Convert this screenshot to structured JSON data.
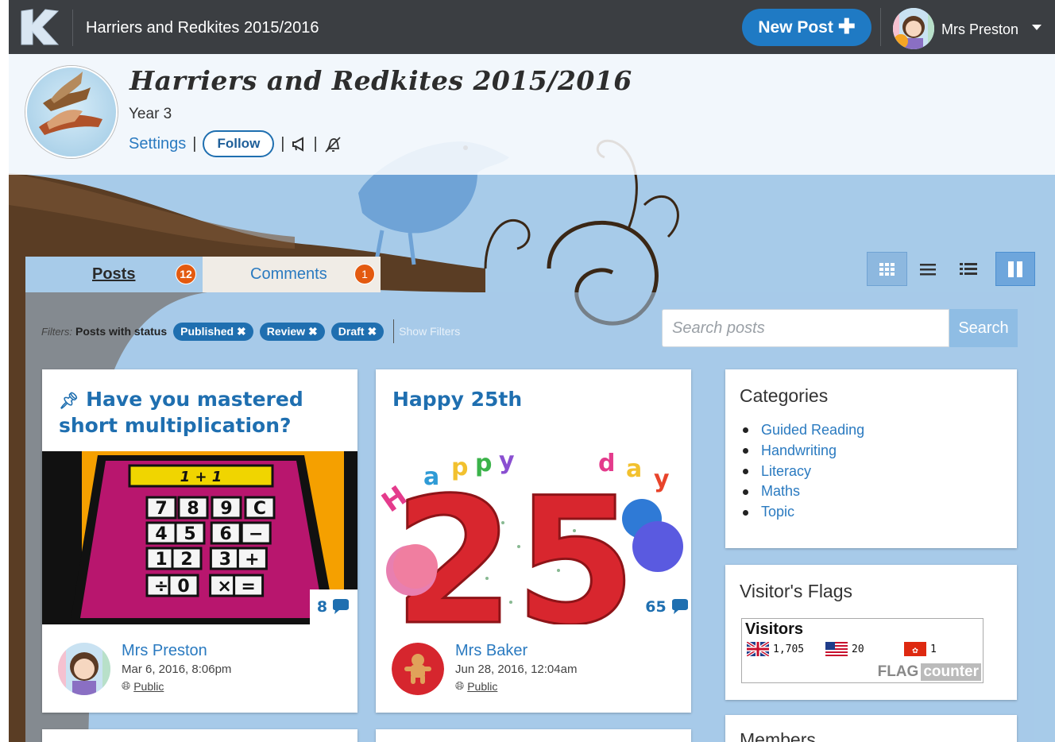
{
  "topbar": {
    "title": "Harriers and Redkites 2015/2016",
    "new_post_label": "New Post",
    "user_name": "Mrs Preston"
  },
  "header": {
    "class_title": "Harriers and Redkites 2015/2016",
    "year": "Year 3",
    "settings_label": "Settings",
    "follow_label": "Follow",
    "separator": "|"
  },
  "tabs": [
    {
      "label": "Posts",
      "count": "12"
    },
    {
      "label": "Comments",
      "count": "1"
    }
  ],
  "filters": {
    "prefix": "Filters:",
    "status_text": "Posts with status",
    "chips": [
      "Published",
      "Review",
      "Draft"
    ],
    "show_filters": "Show Filters"
  },
  "search": {
    "placeholder": "Search posts",
    "button_label": "Search"
  },
  "posts": [
    {
      "title": "Have you mastered short multiplication?",
      "pinned": true,
      "comment_count": "8",
      "author": "Mrs Preston",
      "date": "Mar 6, 2016, 8:06pm",
      "visibility": "Public"
    },
    {
      "title": "Happy 25th",
      "pinned": false,
      "comment_count": "65",
      "author": "Mrs Baker",
      "date": "Jun 28, 2016, 12:04am",
      "visibility": "Public"
    }
  ],
  "calculator_keys": [
    "7",
    "8",
    "9",
    "C",
    "4",
    "5",
    "6",
    "−",
    "1",
    "2",
    "3",
    "+",
    "÷",
    "0",
    "×",
    "="
  ],
  "calculator_display": "1 + 1",
  "birthday_image_text": "25",
  "sidebar": {
    "categories_title": "Categories",
    "categories": [
      "Guided Reading",
      "Handwriting",
      "Literacy",
      "Maths",
      "Topic"
    ],
    "flags_title": "Visitor's Flags",
    "flags_heading": "Visitors",
    "flags": [
      {
        "country": "UK",
        "count": "1,705"
      },
      {
        "country": "US",
        "count": "20"
      },
      {
        "country": "HK",
        "count": "1"
      }
    ],
    "flag_counter_brand": "FLAG",
    "flag_counter_suffix": "counter",
    "members_title": "Members"
  },
  "colors": {
    "topbar": "#3b3e42",
    "accent": "#1f6fb0",
    "link": "#2a7ac0",
    "badge": "#e35a10",
    "background": "#a7cbe9"
  }
}
